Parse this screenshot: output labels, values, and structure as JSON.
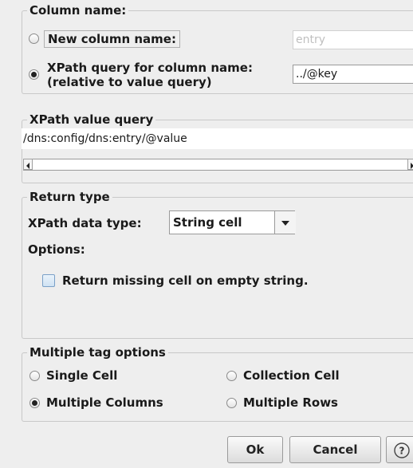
{
  "column_name": {
    "legend": "Column name:",
    "new_column_label": "New column name:",
    "new_column_value": "entry",
    "xpath_label_line1": "XPath query for column name:",
    "xpath_label_line2": "(relative to value query)",
    "xpath_value": "../@key",
    "selected": "xpath"
  },
  "value_query": {
    "legend": "XPath value query",
    "text": "/dns:config/dns:entry/@value"
  },
  "return_type": {
    "legend": "Return type",
    "data_type_label": "XPath data type:",
    "data_type_value": "String cell",
    "options_label": "Options:",
    "missing_cell_label": "Return missing cell on empty string.",
    "missing_cell_checked": false
  },
  "multiple_tag": {
    "legend": "Multiple tag options",
    "single_cell": "Single Cell",
    "collection_cell": "Collection Cell",
    "multiple_columns": "Multiple Columns",
    "multiple_rows": "Multiple Rows",
    "selected": "multiple_columns"
  },
  "buttons": {
    "ok": "Ok",
    "cancel": "Cancel",
    "help_icon": "help-icon"
  }
}
